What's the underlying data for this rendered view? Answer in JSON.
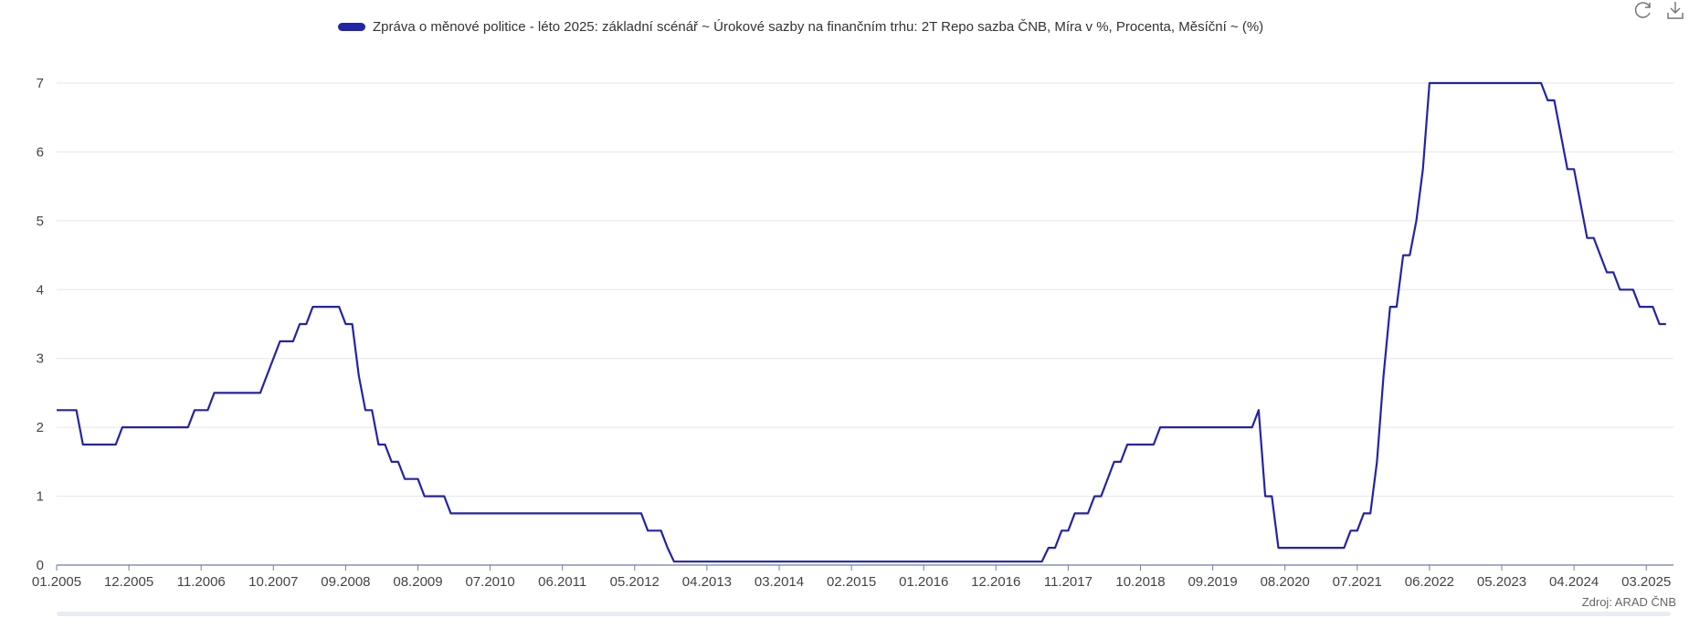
{
  "legend": {
    "label": "Zpráva o měnové politice - léto 2025: základní scénář ~ Úrokové sazby na finančním trhu: 2T Repo sazba ČNB, Míra v %, Procenta, Měsíční ~ (%)",
    "color": "#2323a8"
  },
  "toolbar": {
    "refresh_icon": "refresh-icon",
    "download_icon": "download-icon"
  },
  "source": "Zdroj: ARAD ČNB",
  "chart_data": {
    "type": "line",
    "xlabel": "",
    "ylabel": "",
    "ylim": [
      0,
      7
    ],
    "yticks": [
      0,
      1,
      2,
      3,
      4,
      5,
      6,
      7
    ],
    "grid": true,
    "legend_position": "top",
    "x_tick_labels": [
      "01.2005",
      "12.2005",
      "11.2006",
      "10.2007",
      "09.2008",
      "08.2009",
      "07.2010",
      "06.2011",
      "05.2012",
      "04.2013",
      "03.2014",
      "02.2015",
      "01.2016",
      "12.2016",
      "11.2017",
      "10.2018",
      "09.2019",
      "08.2020",
      "07.2021",
      "06.2022",
      "05.2023",
      "04.2024",
      "03.2025"
    ],
    "series": [
      {
        "name": "Zpráva o měnové politice - léto 2025: základní scénář ~ Úrokové sazby na finančním trhu: 2T Repo sazba ČNB, Míra v %, Procenta, Měsíční ~ (%)",
        "color": "#2323a8",
        "steps": [
          [
            "01.2005",
            2.25
          ],
          [
            "04.2005",
            2.25
          ],
          [
            "05.2005",
            1.75
          ],
          [
            "10.2005",
            1.75
          ],
          [
            "11.2005",
            2.0
          ],
          [
            "09.2006",
            2.0
          ],
          [
            "10.2006",
            2.25
          ],
          [
            "12.2006",
            2.25
          ],
          [
            "01.2007",
            2.5
          ],
          [
            "08.2007",
            2.5
          ],
          [
            "11.2007",
            3.25
          ],
          [
            "01.2008",
            3.25
          ],
          [
            "02.2008",
            3.5
          ],
          [
            "03.2008",
            3.5
          ],
          [
            "04.2008",
            3.75
          ],
          [
            "08.2008",
            3.75
          ],
          [
            "09.2008",
            3.5
          ],
          [
            "10.2008",
            3.5
          ],
          [
            "11.2008",
            2.75
          ],
          [
            "12.2008",
            2.25
          ],
          [
            "01.2009",
            2.25
          ],
          [
            "02.2009",
            1.75
          ],
          [
            "03.2009",
            1.75
          ],
          [
            "04.2009",
            1.5
          ],
          [
            "05.2009",
            1.5
          ],
          [
            "06.2009",
            1.25
          ],
          [
            "08.2009",
            1.25
          ],
          [
            "09.2009",
            1.0
          ],
          [
            "12.2009",
            1.0
          ],
          [
            "01.2010",
            0.75
          ],
          [
            "06.2012",
            0.75
          ],
          [
            "07.2012",
            0.5
          ],
          [
            "09.2012",
            0.5
          ],
          [
            "10.2012",
            0.25
          ],
          [
            "11.2012",
            0.05
          ],
          [
            "07.2017",
            0.05
          ],
          [
            "08.2017",
            0.25
          ],
          [
            "09.2017",
            0.25
          ],
          [
            "10.2017",
            0.5
          ],
          [
            "11.2017",
            0.5
          ],
          [
            "12.2017",
            0.75
          ],
          [
            "02.2018",
            0.75
          ],
          [
            "03.2018",
            1.0
          ],
          [
            "04.2018",
            1.0
          ],
          [
            "06.2018",
            1.5
          ],
          [
            "07.2018",
            1.5
          ],
          [
            "08.2018",
            1.75
          ],
          [
            "12.2018",
            1.75
          ],
          [
            "01.2019",
            2.0
          ],
          [
            "03.2020",
            2.0
          ],
          [
            "04.2020",
            2.25
          ],
          [
            "05.2020",
            1.0
          ],
          [
            "06.2020",
            1.0
          ],
          [
            "07.2020",
            0.25
          ],
          [
            "05.2021",
            0.25
          ],
          [
            "06.2021",
            0.5
          ],
          [
            "07.2021",
            0.5
          ],
          [
            "08.2021",
            0.75
          ],
          [
            "09.2021",
            0.75
          ],
          [
            "10.2021",
            1.5
          ],
          [
            "11.2021",
            2.75
          ],
          [
            "12.2021",
            3.75
          ],
          [
            "01.2022",
            3.75
          ],
          [
            "02.2022",
            4.5
          ],
          [
            "03.2022",
            4.5
          ],
          [
            "04.2022",
            5.0
          ],
          [
            "05.2022",
            5.75
          ],
          [
            "06.2022",
            7.0
          ],
          [
            "11.2023",
            7.0
          ],
          [
            "12.2023",
            6.75
          ],
          [
            "01.2024",
            6.75
          ],
          [
            "02.2024",
            6.25
          ],
          [
            "03.2024",
            5.75
          ],
          [
            "04.2024",
            5.75
          ],
          [
            "06.2024",
            4.75
          ],
          [
            "07.2024",
            4.75
          ],
          [
            "08.2024",
            4.5
          ],
          [
            "09.2024",
            4.25
          ],
          [
            "10.2024",
            4.25
          ],
          [
            "11.2024",
            4.0
          ],
          [
            "01.2025",
            4.0
          ],
          [
            "02.2025",
            3.75
          ],
          [
            "04.2025",
            3.75
          ],
          [
            "05.2025",
            3.5
          ],
          [
            "06.2025",
            3.5
          ]
        ]
      }
    ]
  }
}
